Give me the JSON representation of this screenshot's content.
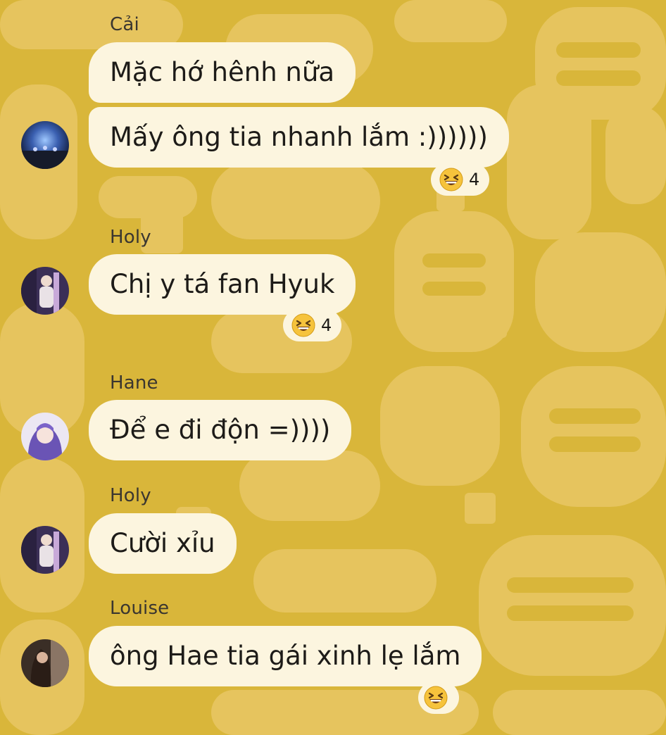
{
  "messages": [
    {
      "sender": "Cải",
      "texts": [
        "Mặc hớ hênh nữa",
        "Mấy ông tia nhanh lắm :))))))"
      ],
      "reaction": {
        "emoji": "grinning-squinting-face",
        "count": "4"
      }
    },
    {
      "sender": "Holy",
      "texts": [
        "Chị y tá fan Hyuk"
      ],
      "reaction": {
        "emoji": "grinning-squinting-face",
        "count": "4"
      }
    },
    {
      "sender": "Hane",
      "texts": [
        "Để e đi độn =))))"
      ]
    },
    {
      "sender": "Holy",
      "texts": [
        "Cười xỉu"
      ]
    },
    {
      "sender": "Louise",
      "texts": [
        "ông Hae tia gái xinh lẹ lắm"
      ],
      "reaction": {
        "emoji": "grinning-squinting-face",
        "count": ""
      }
    }
  ],
  "colors": {
    "background": "#d9b63a",
    "pattern": "#e6c45e",
    "bubble": "#fcf5df",
    "text": "#1d1b18",
    "sender_name": "#3a3630"
  }
}
